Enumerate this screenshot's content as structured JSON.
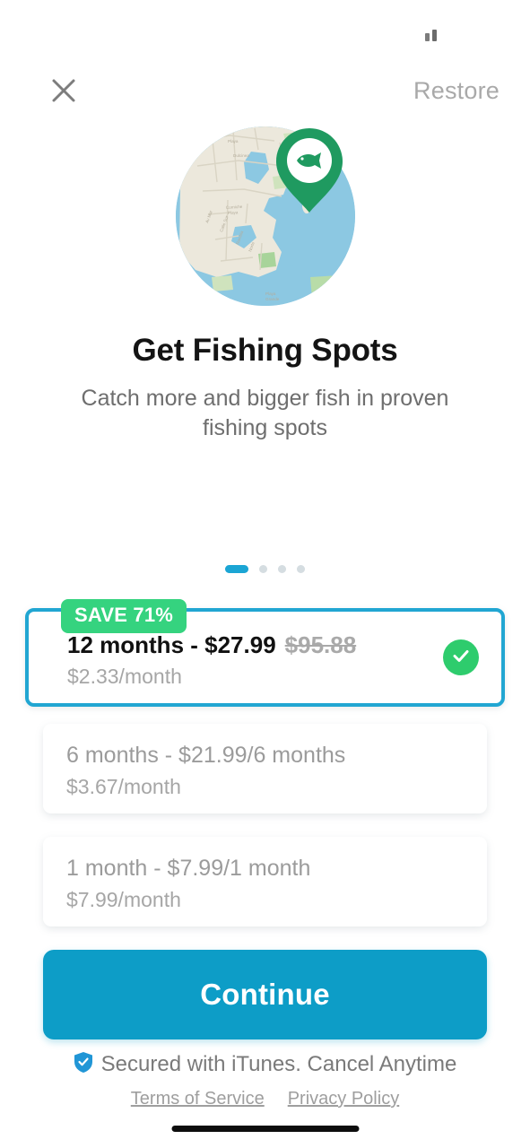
{
  "app": {
    "screen_title": "Get Fishing Spots",
    "background_color": "#ffffff"
  },
  "status_bar": {
    "indicator": "signal-bars"
  },
  "header": {
    "close_label": "close-icon",
    "restore_label": "Restore"
  },
  "hero": {
    "illustration": "globe-map-with-fish-pin",
    "water_color": "#8cc8e2",
    "land_color": "#ece8dc",
    "pin_color": "#1f9a60",
    "fish_color": "#1f9a60"
  },
  "content": {
    "title": "Get Fishing Spots",
    "subtitle": "Catch more and bigger fish in proven fishing spots"
  },
  "carousel": {
    "total_dots": 4,
    "active_index": 0,
    "active_color": "#1ba5d4",
    "inactive_color": "#d5dde1"
  },
  "plans": [
    {
      "badge": "SAVE 71%",
      "main": "12 months - $27.99",
      "strike_price": "$95.88",
      "sub": "$2.33/month",
      "selected": true,
      "border_color": "#21a6d2",
      "badge_color": "#35d37f",
      "check_color": "#2ecc6d"
    },
    {
      "badge": "",
      "main": "6 months - $21.99/6 months",
      "strike_price": "",
      "sub": "$3.67/month",
      "selected": false
    },
    {
      "badge": "",
      "main": "1 month - $7.99/1 month",
      "strike_price": "",
      "sub": "$7.99/month",
      "selected": false
    }
  ],
  "cta": {
    "label": "Continue",
    "color": "#0d9dc7"
  },
  "footer": {
    "secure_icon": "shield-check-icon",
    "secure_icon_color": "#2196d6",
    "secure_text": "Secured with iTunes. Cancel Anytime",
    "terms_label": "Terms of Service",
    "privacy_label": "Privacy Policy"
  }
}
